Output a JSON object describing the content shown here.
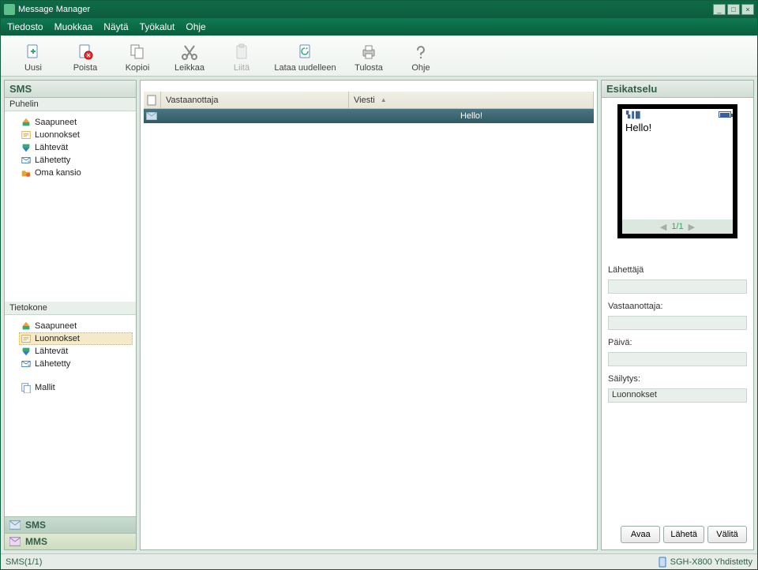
{
  "window": {
    "title": "Message Manager"
  },
  "menu": {
    "file": "Tiedosto",
    "edit": "Muokkaa",
    "view": "Näytä",
    "tools": "Työkalut",
    "help": "Ohje"
  },
  "toolbar": {
    "new": "Uusi",
    "delete": "Poista",
    "copy": "Kopioi",
    "cut": "Leikkaa",
    "paste": "Liitä",
    "reload": "Lataa uudelleen",
    "print": "Tulosta",
    "help": "Ohje"
  },
  "left": {
    "sms_head": "SMS",
    "phone_head": "Puhelin",
    "computer_head": "Tietokone",
    "phone_items": [
      "Saapuneet",
      "Luonnokset",
      "Lähtevät",
      "Lähetetty",
      "Oma kansio"
    ],
    "computer_items": [
      "Saapuneet",
      "Luonnokset",
      "Lähtevät",
      "Lähetetty"
    ],
    "templates": "Mallit",
    "tab_sms": "SMS",
    "tab_mms": "MMS"
  },
  "list": {
    "col_recipient": "Vastaanottaja",
    "col_message": "Viesti",
    "rows": [
      {
        "recipient": "",
        "message": "Hello!"
      }
    ]
  },
  "preview": {
    "head": "Esikatselu",
    "body": "Hello!",
    "pager": "1/1",
    "sender_label": "Lähettäjä",
    "recipient_label": "Vastaanottaja:",
    "date_label": "Päivä:",
    "storage_label": "Säilytys:",
    "storage_value": "Luonnokset",
    "btn_open": "Avaa",
    "btn_send": "Lähetä",
    "btn_forward": "Välitä"
  },
  "status": {
    "left": "SMS(1/1)",
    "right": "SGH-X800 Yhdistetty"
  }
}
